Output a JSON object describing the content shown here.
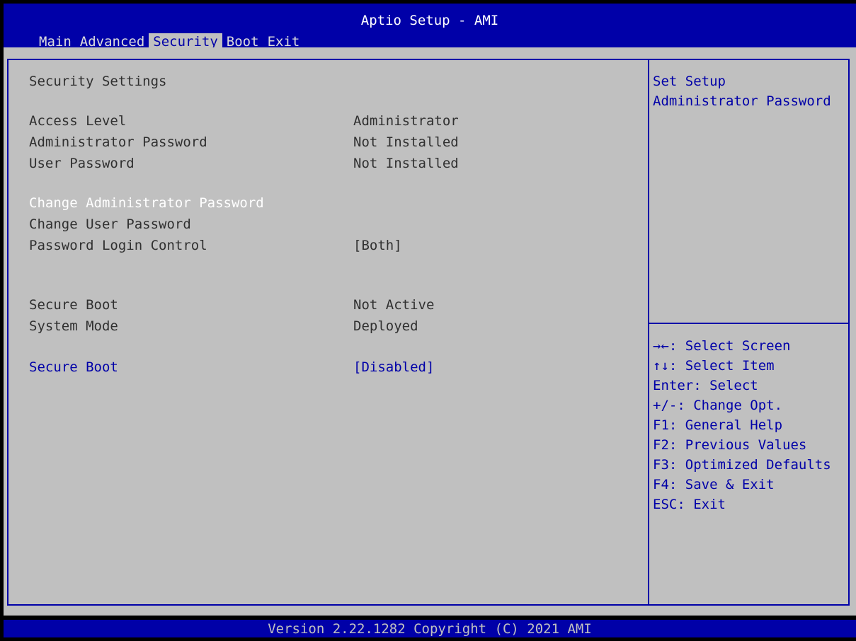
{
  "header": {
    "title": "Aptio Setup - AMI",
    "tabs": [
      {
        "label": "Main"
      },
      {
        "label": "Advanced"
      },
      {
        "label": "Security"
      },
      {
        "label": "Boot"
      },
      {
        "label": "Exit"
      }
    ],
    "active_tab": "Security"
  },
  "settings": {
    "section_title": "Security Settings",
    "access_level": {
      "label": "Access Level",
      "value": "Administrator"
    },
    "admin_password": {
      "label": "Administrator Password",
      "value": "Not Installed"
    },
    "user_password": {
      "label": "User Password",
      "value": "Not Installed"
    },
    "change_admin_password": {
      "label": "Change Administrator Password"
    },
    "change_user_password": {
      "label": "Change User Password"
    },
    "password_login_control": {
      "label": "Password Login Control",
      "value": "[Both]"
    },
    "secure_boot_status": {
      "label": "Secure Boot",
      "value": "Not Active"
    },
    "system_mode": {
      "label": "System Mode",
      "value": "Deployed"
    },
    "secure_boot_option": {
      "label": "Secure Boot",
      "value": "[Disabled]"
    }
  },
  "help": {
    "text_line1": "Set Setup",
    "text_line2": "Administrator Password",
    "keys": [
      "→←: Select Screen",
      "↑↓: Select Item",
      "Enter: Select",
      "+/-: Change Opt.",
      "F1: General Help",
      "F2: Previous Values",
      "F3: Optimized Defaults",
      "F4: Save & Exit",
      "ESC: Exit"
    ]
  },
  "footer": {
    "version": "Version 2.22.1282 Copyright (C) 2021 AMI"
  },
  "colors": {
    "background": "#c0c0c0",
    "accent_blue": "#0000a8",
    "selected_text": "#ffffff",
    "normal_text": "#303030"
  }
}
